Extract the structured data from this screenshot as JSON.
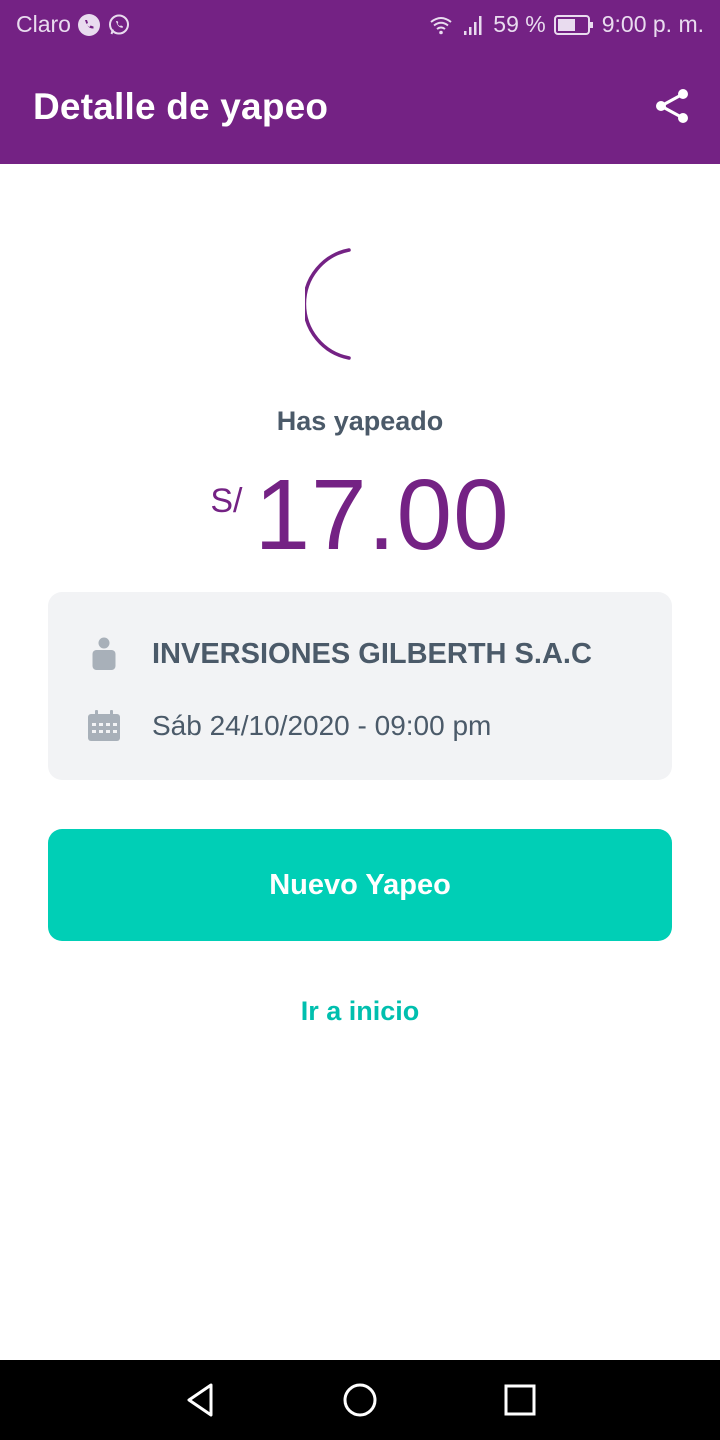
{
  "status_bar": {
    "carrier": "Claro",
    "battery": "59 %",
    "time": "9:00 p. m.",
    "icons": [
      "phone-icon",
      "whatsapp-icon",
      "wifi-icon",
      "signal-icon",
      "battery-icon"
    ]
  },
  "app_bar": {
    "title": "Detalle de yapeo",
    "share_icon": "share-icon"
  },
  "receipt": {
    "label": "Has yapeado",
    "currency": "S/",
    "amount": "17.00",
    "recipient": "INVERSIONES GILBERTH S.A.C",
    "datetime": "Sáb 24/10/2020 - 09:00 pm"
  },
  "actions": {
    "new_payment": "Nuevo Yapeo",
    "go_home": "Ir a inicio"
  },
  "colors": {
    "brand_purple": "#742284",
    "accent_teal": "#00cfb6",
    "text_gray": "#4b5a69",
    "card_bg": "#f2f3f5"
  }
}
